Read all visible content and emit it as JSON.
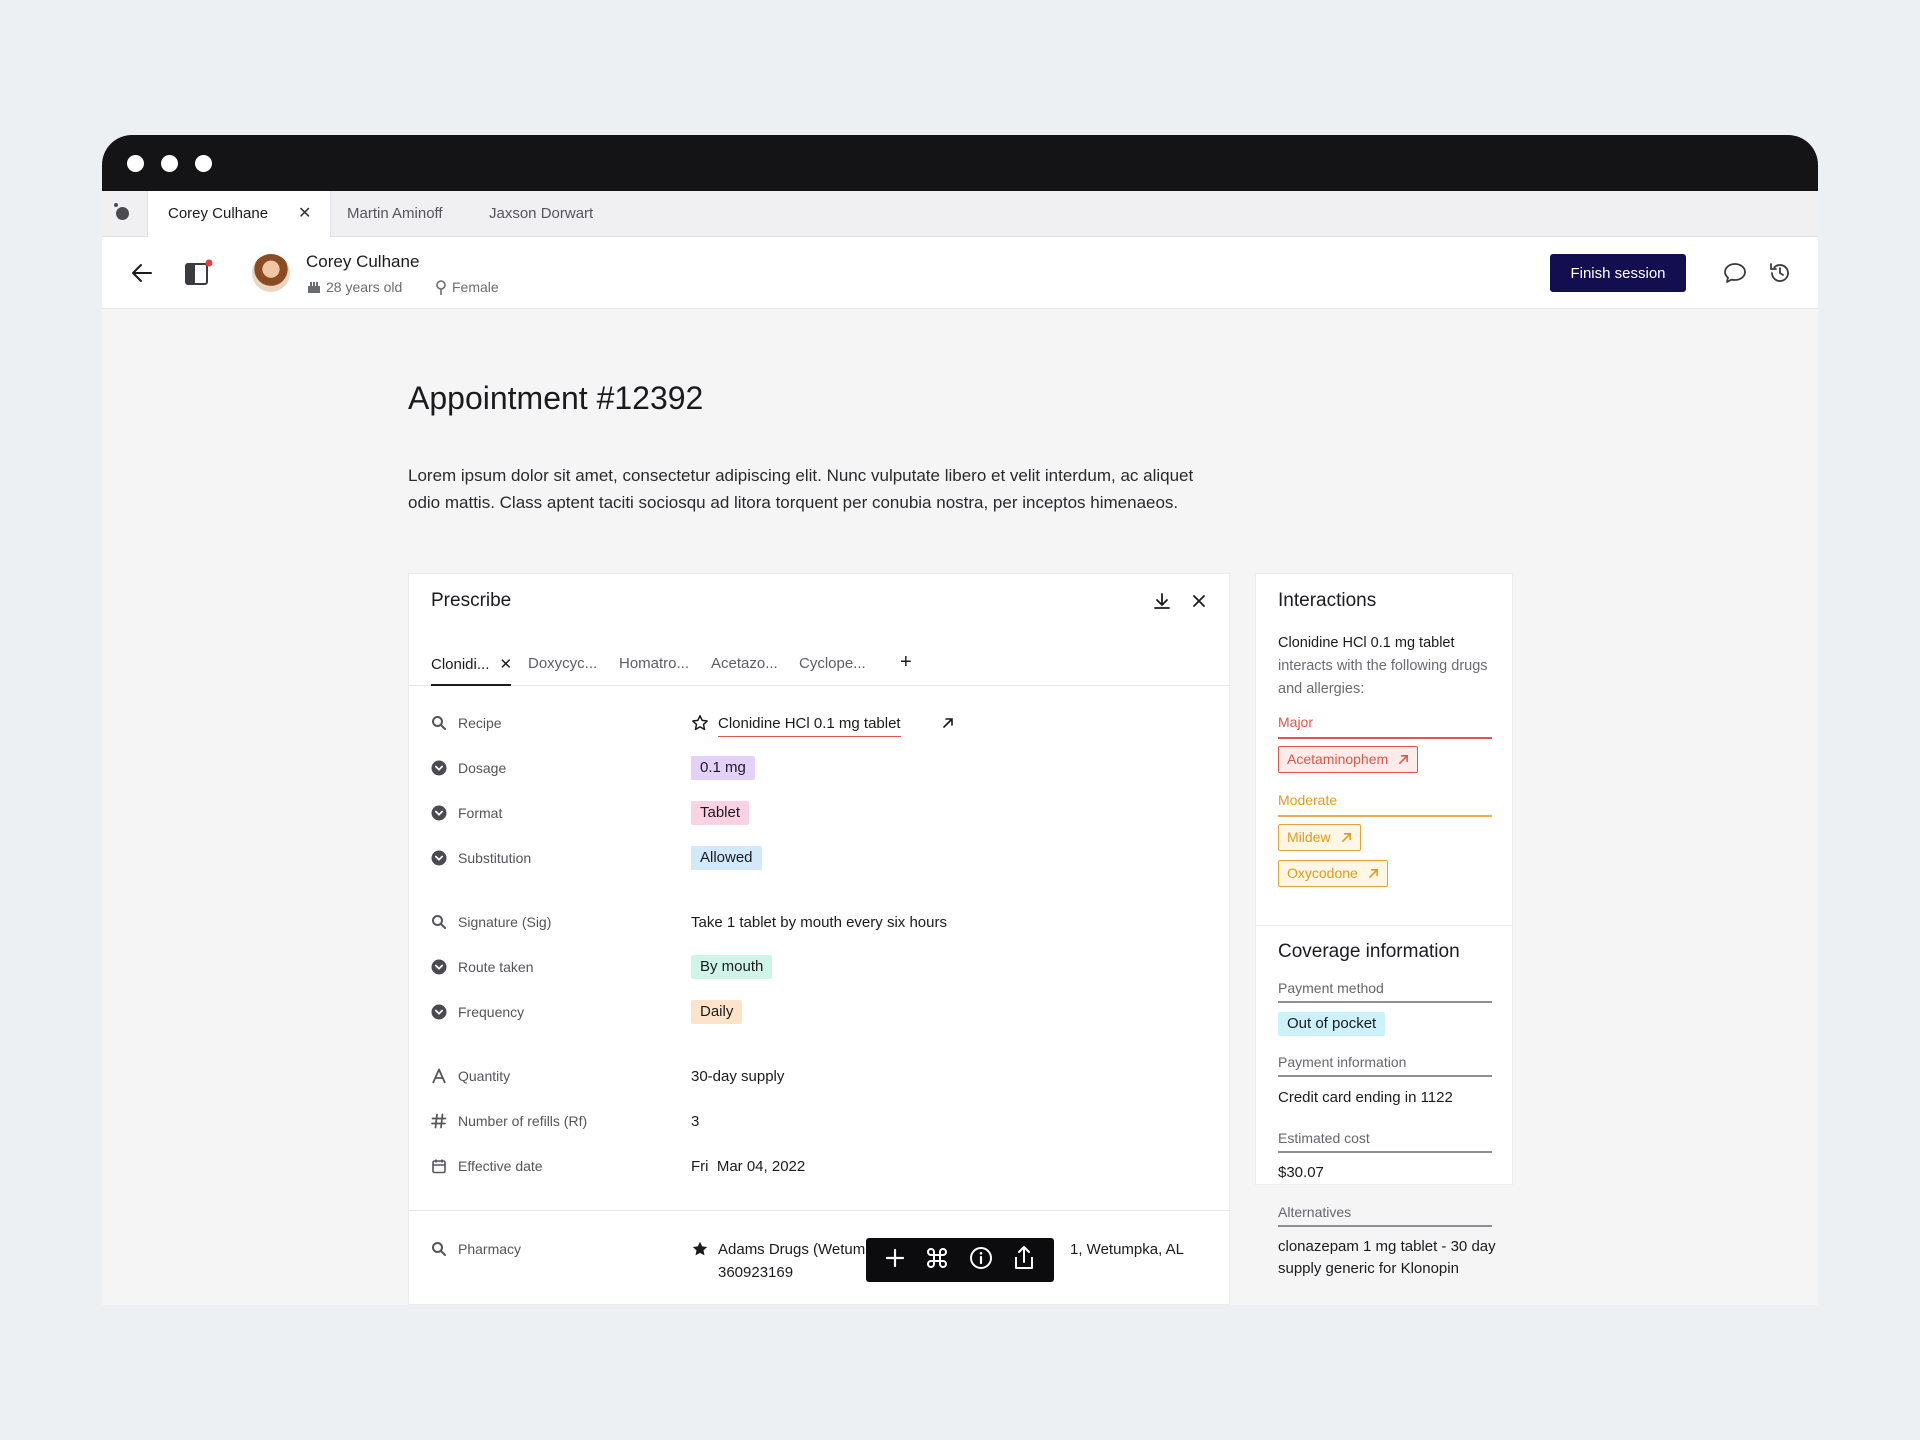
{
  "tabs": [
    {
      "label": "Corey Culhane",
      "active": true
    },
    {
      "label": "Martin Aminoff",
      "active": false
    },
    {
      "label": "Jaxson Dorwart",
      "active": false
    }
  ],
  "patient": {
    "name": "Corey Culhane",
    "age": "28 years old",
    "gender": "Female"
  },
  "header": {
    "finish_label": "Finish session"
  },
  "appointment": {
    "title": "Appointment #12392",
    "description": "Lorem ipsum dolor sit amet, consectetur adipiscing elit. Nunc vulputate libero et velit interdum, ac aliquet odio mattis. Class aptent taciti sociosqu ad litora torquent per conubia nostra, per inceptos himenaeos."
  },
  "prescribe": {
    "title": "Prescribe",
    "drug_tabs": [
      "Clonidi...",
      "Doxycyc...",
      "Homatro...",
      "Acetazo...",
      "Cyclope..."
    ],
    "recipe": {
      "label": "Recipe",
      "value": "Clonidine HCl 0.1 mg tablet"
    },
    "dosage": {
      "label": "Dosage",
      "value": "0.1 mg"
    },
    "format": {
      "label": "Format",
      "value": "Tablet"
    },
    "substitution": {
      "label": "Substitution",
      "value": "Allowed"
    },
    "signature": {
      "label": "Signature (Sig)",
      "value": "Take 1 tablet by mouth every six hours"
    },
    "route": {
      "label": "Route taken",
      "value": "By mouth"
    },
    "frequency": {
      "label": "Frequency",
      "value": "Daily"
    },
    "quantity": {
      "label": "Quantity",
      "value": "30-day supply"
    },
    "refills": {
      "label": "Number of refills (Rf)",
      "value": "3"
    },
    "effective_date": {
      "label": "Effective date",
      "day": "Fri",
      "value": "Mar 04, 2022"
    },
    "pharmacy": {
      "label": "Pharmacy",
      "line1_start": "Adams Drugs (Wetum",
      "line1_end": "1, Wetumpka, AL",
      "line2": "360923169"
    }
  },
  "interactions": {
    "title": "Interactions",
    "drug": "Clonidine HCl 0.1 mg tablet",
    "text": "interacts with the following drugs and allergies:",
    "major_label": "Major",
    "major": [
      "Acetaminophem"
    ],
    "moderate_label": "Moderate",
    "moderate": [
      "Mildew",
      "Oxycodone"
    ]
  },
  "coverage": {
    "title": "Coverage information",
    "payment_method_label": "Payment method",
    "payment_method": "Out of pocket",
    "payment_info_label": "Payment information",
    "payment_info": "Credit card ending in 1122",
    "cost_label": "Estimated cost",
    "cost": "$30.07",
    "alternatives_label": "Alternatives",
    "alternatives": "clonazepam 1 mg tablet - 30 day supply generic for Klonopin"
  },
  "colors": {
    "primary": "#130e4f",
    "major": "#e0554a",
    "moderate": "#e39a1c",
    "dosage_pill": "#e3d1f7",
    "format_pill": "#fad2e2",
    "substitution_pill": "#d2e9fb",
    "route_pill": "#cff5e9",
    "frequency_pill": "#fde3c9",
    "payment_pill": "#cdf1f8"
  }
}
